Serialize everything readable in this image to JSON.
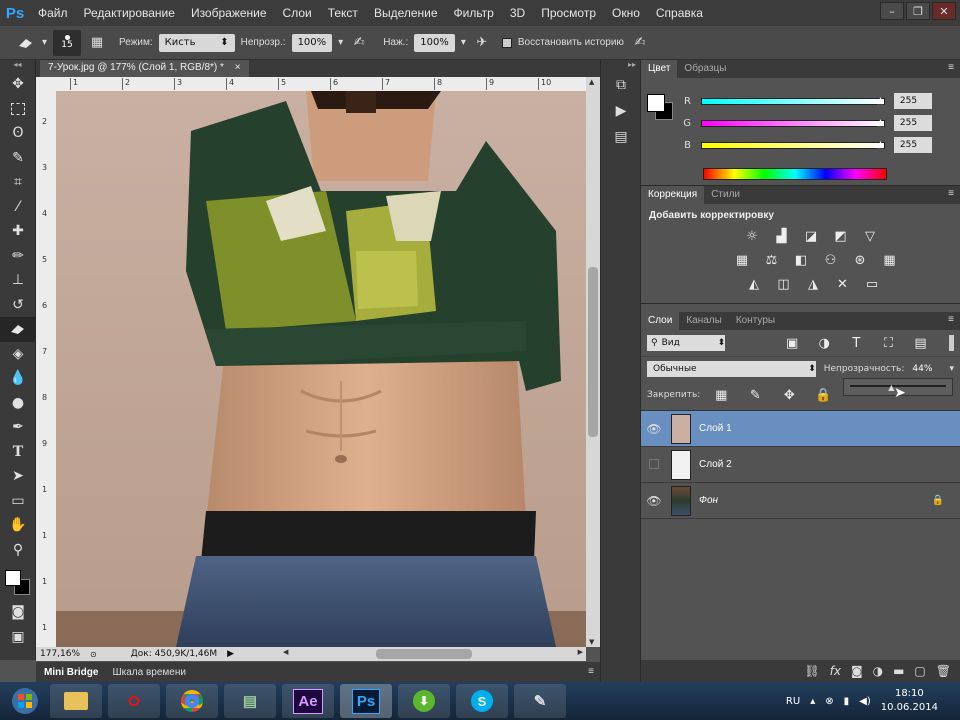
{
  "app": {
    "logo": "Ps"
  },
  "menu": [
    "Файл",
    "Редактирование",
    "Изображение",
    "Слои",
    "Текст",
    "Выделение",
    "Фильтр",
    "3D",
    "Просмотр",
    "Окно",
    "Справка"
  ],
  "window_controls": [
    "–",
    "❐",
    "✕"
  ],
  "options": {
    "brush_size": "15",
    "mode_label": "Режим:",
    "mode_value": "Кисть",
    "opacity_label": "Непрозр.:",
    "opacity_value": "100%",
    "flow_label": "Наж.:",
    "flow_value": "100%",
    "history_label": "Восстановить историю"
  },
  "document": {
    "tab_title": "7-Урок.jpg @ 177% (Слой 1, RGB/8*) *",
    "tab_close": "×",
    "ruler_top": [
      "1",
      "2",
      "3",
      "4",
      "5",
      "6",
      "7",
      "8",
      "9",
      "10"
    ],
    "ruler_left": [
      "2",
      "3",
      "4",
      "5",
      "6",
      "7",
      "8",
      "9",
      "1",
      "1",
      "1",
      "1"
    ],
    "zoom": "177,16%",
    "doc_size": "Док: 450,9K/1,46M"
  },
  "bottom_tabs": [
    "Mini Bridge",
    "Шкала времени"
  ],
  "color_panel": {
    "tabs": [
      "Цвет",
      "Образцы"
    ],
    "channels": [
      {
        "label": "R",
        "value": "255",
        "gradient": "#00ffff,#ffffff"
      },
      {
        "label": "G",
        "value": "255",
        "gradient": "#ff00ff,#ffffff"
      },
      {
        "label": "B",
        "value": "255",
        "gradient": "#ffff00,#ffffff"
      }
    ]
  },
  "adjust_panel": {
    "tabs": [
      "Коррекция",
      "Стили"
    ],
    "title": "Добавить корректировку"
  },
  "layers_panel": {
    "tabs": [
      "Слои",
      "Каналы",
      "Контуры"
    ],
    "filter_label": "Вид",
    "blend_mode": "Обычные",
    "opacity_label": "Непрозрачность:",
    "opacity_value": "44%",
    "opacity_fraction": 0.44,
    "lock_label": "Закрепить:",
    "layers": [
      {
        "name": "Слой 1",
        "visible": true,
        "selected": true
      },
      {
        "name": "Слой 2",
        "visible": false,
        "selected": false
      },
      {
        "name": "Фон",
        "visible": true,
        "selected": false,
        "locked": true
      }
    ]
  },
  "taskbar": {
    "lang": "RU",
    "time": "18:10",
    "date": "10.06.2014",
    "apps": [
      "",
      "O",
      "",
      "",
      "Ae",
      "Ps",
      "",
      "S",
      ""
    ]
  },
  "colors": {
    "selected_layer": "#698fc0",
    "ps_blue": "#31a8ff"
  }
}
